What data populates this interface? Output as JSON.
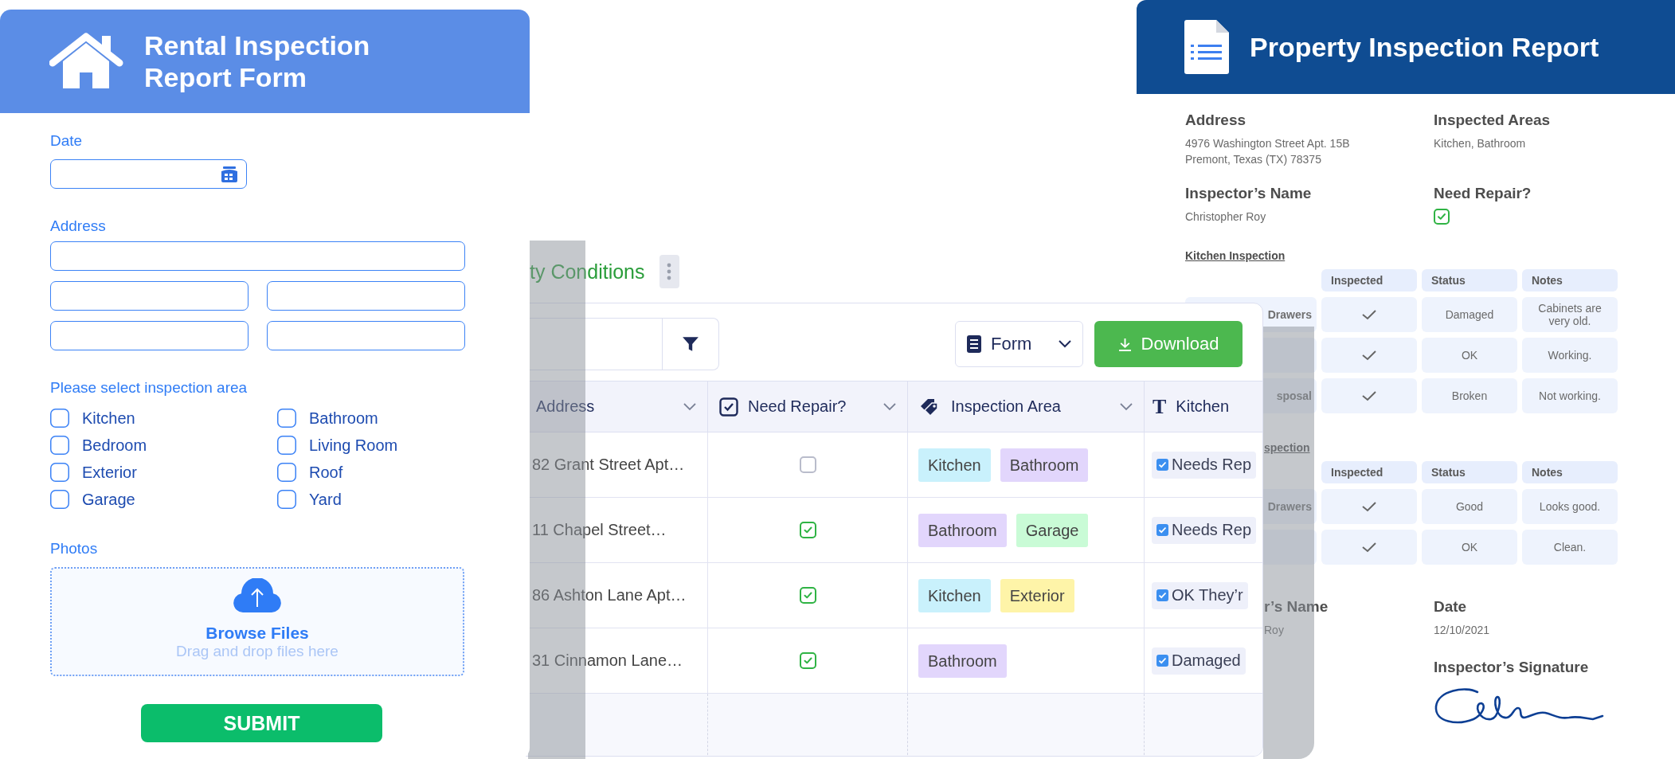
{
  "form": {
    "title": "Rental Inspection Report Form",
    "date_label": "Date",
    "address_label": "Address",
    "area_label": "Please select inspection area",
    "areas": [
      {
        "label": "Kitchen",
        "checked": false
      },
      {
        "label": "Bathroom",
        "checked": false
      },
      {
        "label": "Bedroom",
        "checked": false
      },
      {
        "label": "Living Room",
        "checked": false
      },
      {
        "label": "Exterior",
        "checked": false
      },
      {
        "label": "Roof",
        "checked": false
      },
      {
        "label": "Garage",
        "checked": false
      },
      {
        "label": "Yard",
        "checked": false
      }
    ],
    "photos": {
      "label": "Photos",
      "browse": "Browse Files",
      "hint": "Drag and drop files here"
    },
    "submit": "SUBMIT"
  },
  "table": {
    "title": "ty Conditions",
    "view": "Form",
    "download": "Download",
    "columns": [
      {
        "label": "Address",
        "kind": "plain"
      },
      {
        "label": "Need Repair?",
        "kind": "checkbox"
      },
      {
        "label": "Inspection Area",
        "kind": "tags"
      },
      {
        "label": "Kitchen",
        "kind": "text",
        "glyph": "T"
      }
    ],
    "rows": [
      {
        "address": "82 Grant Street Apt…",
        "need_repair": false,
        "areas": [
          {
            "label": "Kitchen",
            "color": "#c9f1fc"
          },
          {
            "label": "Bathroom",
            "color": "#e2d6fc"
          }
        ],
        "kitchen": {
          "checked": true,
          "text": "Needs Rep"
        }
      },
      {
        "address": "11 Chapel Street…",
        "need_repair": true,
        "areas": [
          {
            "label": "Bathroom",
            "color": "#e2d6fc"
          },
          {
            "label": "Garage",
            "color": "#c9fbd6"
          }
        ],
        "kitchen": {
          "checked": true,
          "text": "Needs Rep"
        }
      },
      {
        "address": "86 Ashton Lane Apt…",
        "need_repair": true,
        "areas": [
          {
            "label": "Kitchen",
            "color": "#c9f1fc"
          },
          {
            "label": "Exterior",
            "color": "#fef4a8"
          }
        ],
        "kitchen": {
          "checked": true,
          "text": "OK  They’r"
        }
      },
      {
        "address": "31 Cinnamon Lane…",
        "need_repair": true,
        "areas": [
          {
            "label": "Bathroom",
            "color": "#e2d6fc"
          }
        ],
        "kitchen": {
          "checked": true,
          "text": "Damaged"
        }
      }
    ]
  },
  "report": {
    "title": "Property Inspection Report",
    "address": {
      "label": "Address",
      "lines": [
        "4976 Washington Street Apt. 15B",
        "Premont, Texas (TX) 78375"
      ]
    },
    "areas": {
      "label": "Inspected Areas",
      "value": "Kitchen, Bathroom"
    },
    "inspector": {
      "label": "Inspector’s Name",
      "value": "Christopher Roy"
    },
    "need_repair": {
      "label": "Need Repair?",
      "checked": true
    },
    "sections": [
      {
        "title": "Kitchen Inspection",
        "columns": [
          "Inspected",
          "Status",
          "Notes"
        ],
        "rows": [
          {
            "label": "Drawers",
            "inspected": true,
            "status": "Damaged",
            "notes": "Cabinets are very old."
          },
          {
            "inspected": true,
            "status": "OK",
            "notes": "Working."
          },
          {
            "label": "sposal",
            "inspected": true,
            "status": "Broken",
            "notes": "Not working."
          }
        ]
      },
      {
        "title": "spection",
        "columns": [
          "Inspected",
          "Status",
          "Notes"
        ],
        "rows": [
          {
            "label": "Drawers",
            "inspected": true,
            "status": "Good",
            "notes": "Looks good."
          },
          {
            "inspected": true,
            "status": "OK",
            "notes": "Clean."
          }
        ]
      }
    ],
    "footer": {
      "name_label": "r’s Name",
      "name_value": "Roy",
      "date_label": "Date",
      "date_value": "12/10/2021",
      "signature_label": "Inspector’s Signature"
    }
  }
}
